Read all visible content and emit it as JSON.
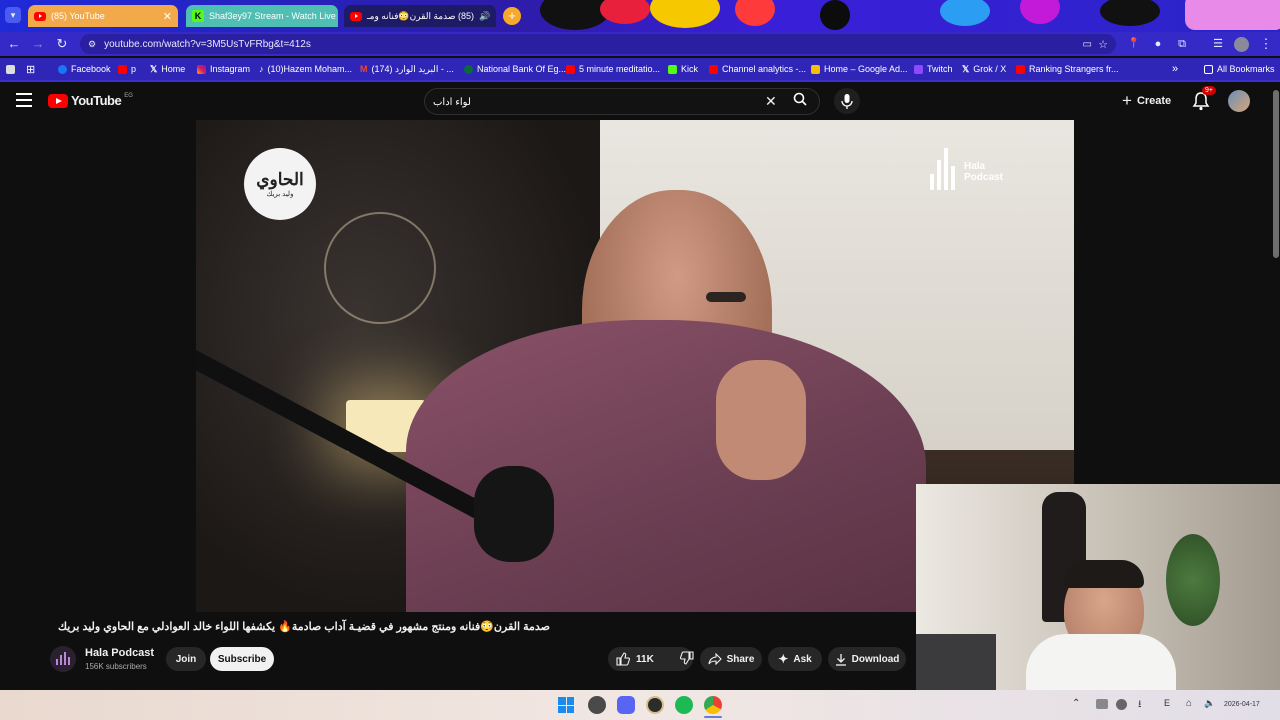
{
  "tabs": [
    {
      "title": "(85) YouTube"
    },
    {
      "title": "Shaf3ey97 Stream - Watch Live"
    },
    {
      "title": "(85) صدمة القرن😳فنانه ومـ"
    }
  ],
  "address": {
    "url": "youtube.com/watch?v=3M5UsTvFRbg&t=412s"
  },
  "bookmarks": [
    {
      "label": "Facebook"
    },
    {
      "label": "p"
    },
    {
      "label": "Home"
    },
    {
      "label": "Instagram"
    },
    {
      "label": "(10)Hazem Moham..."
    },
    {
      "label": "(174) البريد الوارد - ..."
    },
    {
      "label": "National Bank Of Eg..."
    },
    {
      "label": "5 minute meditatio..."
    },
    {
      "label": "Kick"
    },
    {
      "label": "Channel analytics -..."
    },
    {
      "label": "Home – Google Ad..."
    },
    {
      "label": "Twitch"
    },
    {
      "label": "Grok / X"
    },
    {
      "label": "Ranking Strangers fr..."
    },
    {
      "label": "All Bookmarks"
    }
  ],
  "youtube": {
    "logo_text": "YouTube",
    "region": "EG",
    "search_value": "لواء اداب",
    "create_label": "Create",
    "notif_badge": "9+"
  },
  "video": {
    "overlay_left_logo": "الحاوي",
    "overlay_left_sub": "وليد بريك",
    "overlay_right_top": "Hala",
    "overlay_right_bottom": "Podcast",
    "title": "صدمة القرن😳فنانه ومنتج مشهور في قضيـة آداب صادمة🔥 يكشفها اللواء خالد العوادلي مع الحاوي وليد بريك",
    "channel": "Hala Podcast",
    "subscribers": "156K subscribers",
    "join_label": "Join",
    "subscribe_label": "Subscribe",
    "likes": "11K",
    "share_label": "Share",
    "ask_label": "Ask",
    "download_label": "Download"
  },
  "taskbar": {
    "date": "2026-04-17",
    "lang": "E"
  },
  "colors": {
    "tab_active": "#2a2a6a",
    "youtube_red": "#ff0000",
    "subscribe_bg": "#f1f1f1",
    "omnibox": "#2a1fa0"
  }
}
